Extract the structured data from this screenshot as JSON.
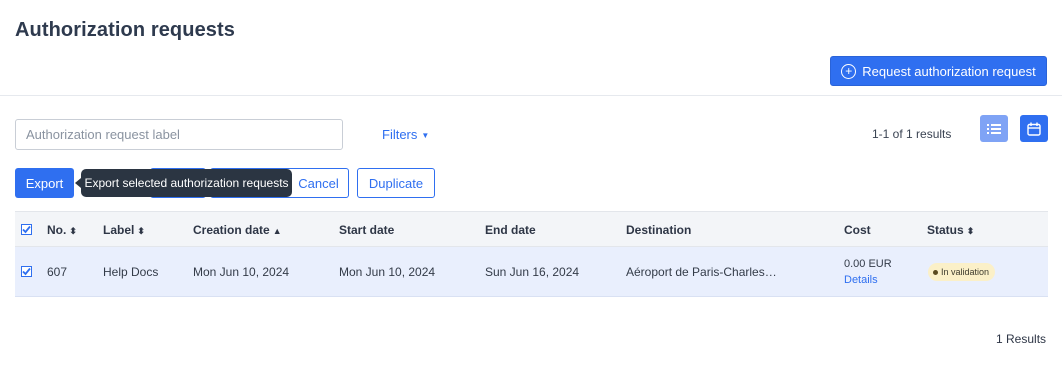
{
  "page": {
    "title": "Authorization requests"
  },
  "header": {
    "request_button_label": "Request authorization request",
    "request_button_icon": "plus-circle-icon"
  },
  "toolbar": {
    "search_placeholder": "Authorization request label",
    "search_value": "",
    "filters_label": "Filters",
    "results_count": "1-1 of 1 results",
    "views": [
      "list-view-icon",
      "calendar-icon"
    ]
  },
  "actions": {
    "export_label": "Export",
    "tooltip": "Export selected authorization requests",
    "cancel_label": "Cancel",
    "duplicate_label": "Duplicate"
  },
  "table": {
    "headers": [
      "No.",
      "Label",
      "Creation date",
      "Start date",
      "End date",
      "Destination",
      "Cost",
      "Status"
    ],
    "rows": [
      {
        "no": "607",
        "label": "Help Docs",
        "creation_date": "Mon Jun 10, 2024",
        "start_date": "Mon Jun 10, 2024",
        "end_date": "Sun Jun 16, 2024",
        "destination": "Aéroport de Paris-Charles…",
        "cost": "0.00 EUR",
        "cost_link": "Details",
        "status": "In validation",
        "selected": true
      }
    ]
  },
  "footer": {
    "results": "1 Results"
  },
  "colors": {
    "accent": "#2f6ff0",
    "badge_bg": "#fbf0c8",
    "row_selected": "#e9effd"
  }
}
